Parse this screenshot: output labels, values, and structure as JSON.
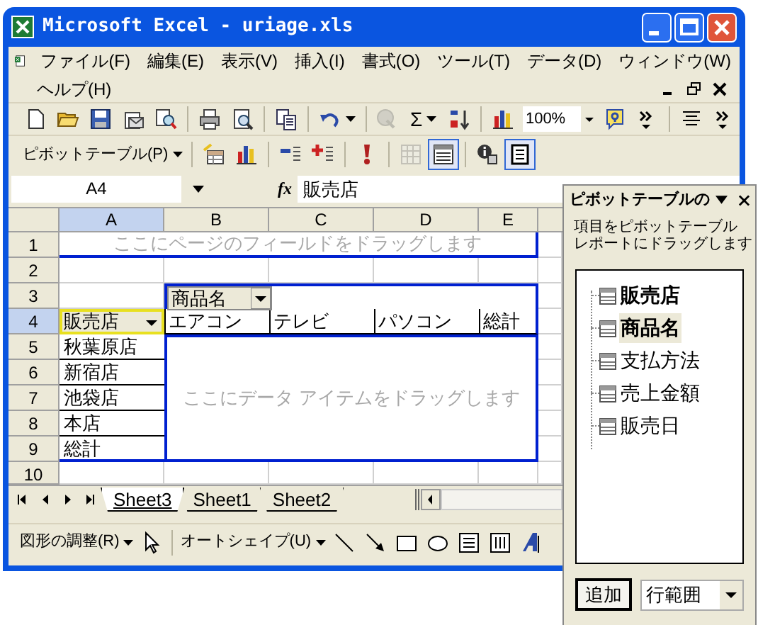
{
  "window": {
    "title": "Microsoft Excel - uriage.xls"
  },
  "menu": [
    {
      "label": "ファイル(F)"
    },
    {
      "label": "編集(E)"
    },
    {
      "label": "表示(V)"
    },
    {
      "label": "挿入(I)"
    },
    {
      "label": "書式(O)"
    },
    {
      "label": "ツール(T)"
    },
    {
      "label": "データ(D)"
    },
    {
      "label": "ウィンドウ(W)"
    },
    {
      "label": "ヘルプ(H)"
    }
  ],
  "standard_toolbar": [
    {
      "kind": "new",
      "disabled": false
    },
    {
      "kind": "open",
      "disabled": false
    },
    {
      "kind": "save",
      "disabled": false
    },
    {
      "kind": "envelope",
      "disabled": false
    },
    {
      "kind": "research",
      "disabled": false
    },
    {
      "kind": "separator"
    },
    {
      "kind": "print",
      "disabled": false
    },
    {
      "kind": "preview",
      "disabled": false
    },
    {
      "kind": "separator"
    },
    {
      "kind": "copy",
      "disabled": false
    },
    {
      "kind": "separator"
    },
    {
      "kind": "undo",
      "disabled": false
    },
    {
      "kind": "separator"
    },
    {
      "kind": "globe",
      "disabled": true
    },
    {
      "kind": "sum",
      "label": "Σ"
    },
    {
      "kind": "sort",
      "disabled": false
    },
    {
      "kind": "separator"
    },
    {
      "kind": "chart",
      "disabled": false
    },
    {
      "kind": "zoom",
      "value": "100%"
    },
    {
      "kind": "help",
      "disabled": false
    },
    {
      "kind": "chevron",
      "disabled": false
    },
    {
      "kind": "separator"
    },
    {
      "kind": "align",
      "disabled": false
    },
    {
      "kind": "chevron",
      "disabled": false
    }
  ],
  "pivot_toolbar": [
    {
      "kind": "menu",
      "label": "ピボットテーブル(P)"
    },
    {
      "kind": "separator"
    },
    {
      "kind": "format-report",
      "pressed": false,
      "disabled": false
    },
    {
      "kind": "chart",
      "pressed": false,
      "disabled": false
    },
    {
      "kind": "separator"
    },
    {
      "kind": "hide-detail",
      "pressed": false,
      "disabled": false
    },
    {
      "kind": "show-detail",
      "pressed": false,
      "disabled": false
    },
    {
      "kind": "separator"
    },
    {
      "kind": "refresh",
      "pressed": false,
      "disabled": false
    },
    {
      "kind": "separator"
    },
    {
      "kind": "grid",
      "pressed": false,
      "disabled": true
    },
    {
      "kind": "field-list",
      "pressed": true,
      "disabled": false
    },
    {
      "kind": "separator"
    },
    {
      "kind": "field-settings",
      "pressed": false,
      "disabled": false
    },
    {
      "kind": "document",
      "pressed": true,
      "disabled": false
    }
  ],
  "formula_bar": {
    "name_box": "A4",
    "function_label": "fx",
    "formula": "販売店"
  },
  "sheet": {
    "columns": [
      {
        "label": "A",
        "selected": true
      },
      {
        "label": "B",
        "selected": false
      },
      {
        "label": "C",
        "selected": false
      },
      {
        "label": "D",
        "selected": false
      },
      {
        "label": "E",
        "selected": false
      }
    ],
    "rows": [
      {
        "label": "1",
        "selected": false
      },
      {
        "label": "2",
        "selected": false
      },
      {
        "label": "3",
        "selected": false
      },
      {
        "label": "4",
        "selected": true
      },
      {
        "label": "5",
        "selected": false
      },
      {
        "label": "6",
        "selected": false
      },
      {
        "label": "7",
        "selected": false
      },
      {
        "label": "8",
        "selected": false
      },
      {
        "label": "9",
        "selected": false
      },
      {
        "label": "10",
        "selected": false
      }
    ]
  },
  "pivot": {
    "page_area_hint": "ここにページのフィールドをドラッグします",
    "column_field": "商品名",
    "row_field": "販売店",
    "column_items": [
      "エアコン",
      "テレビ",
      "パソコン",
      "総計"
    ],
    "row_items": [
      "秋葉原店",
      "新宿店",
      "池袋店",
      "本店",
      "総計"
    ],
    "data_area_hint": "ここにデータ アイテムをドラッグします"
  },
  "sheet_tabs": [
    {
      "label": "Sheet3",
      "selected": true
    },
    {
      "label": "Sheet1",
      "selected": false
    },
    {
      "label": "Sheet2",
      "selected": false
    }
  ],
  "drawing_toolbar": [
    {
      "kind": "menu",
      "label": "図形の調整(R)"
    },
    {
      "kind": "pointer"
    },
    {
      "kind": "separator"
    },
    {
      "kind": "menu",
      "label": "オートシェイプ(U)"
    },
    {
      "kind": "line"
    },
    {
      "kind": "arrow"
    },
    {
      "kind": "rectangle"
    },
    {
      "kind": "oval"
    },
    {
      "kind": "textbox"
    },
    {
      "kind": "vertical-textbox"
    },
    {
      "kind": "wordart"
    }
  ],
  "field_list": {
    "title": "ピボットテーブルの",
    "hint_lines": [
      "項目をピボットテーブル",
      "レポートにドラッグします"
    ],
    "fields": [
      {
        "label": "販売店",
        "in_use": true,
        "selected": false
      },
      {
        "label": "商品名",
        "in_use": true,
        "selected": true
      },
      {
        "label": "支払方法",
        "in_use": false,
        "selected": false
      },
      {
        "label": "売上金額",
        "in_use": false,
        "selected": false
      },
      {
        "label": "販売日",
        "in_use": false,
        "selected": false
      }
    ],
    "add_button": "追加",
    "area_dropdown": "行範囲"
  }
}
